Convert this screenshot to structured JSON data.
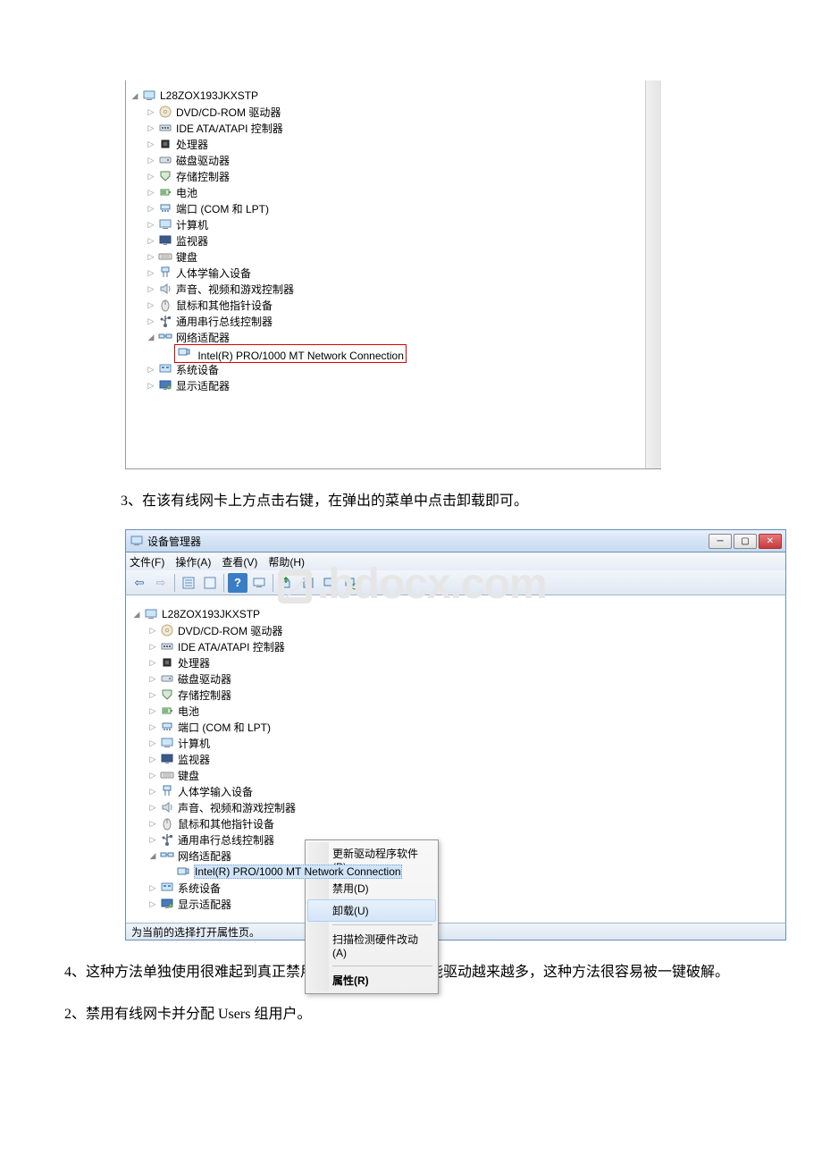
{
  "tree1": {
    "root": "L28ZOX193JKXSTP",
    "items": [
      {
        "label": "DVD/CD-ROM 驱动器",
        "icon": "disc"
      },
      {
        "label": "IDE ATA/ATAPI 控制器",
        "icon": "ide"
      },
      {
        "label": "处理器",
        "icon": "cpu"
      },
      {
        "label": "磁盘驱动器",
        "icon": "drive"
      },
      {
        "label": "存储控制器",
        "icon": "storage"
      },
      {
        "label": "电池",
        "icon": "battery"
      },
      {
        "label": "端口 (COM 和 LPT)",
        "icon": "port"
      },
      {
        "label": "计算机",
        "icon": "computer"
      },
      {
        "label": "监视器",
        "icon": "monitor"
      },
      {
        "label": "键盘",
        "icon": "keyboard"
      },
      {
        "label": "人体学输入设备",
        "icon": "hid"
      },
      {
        "label": "声音、视频和游戏控制器",
        "icon": "sound"
      },
      {
        "label": "鼠标和其他指针设备",
        "icon": "mouse"
      },
      {
        "label": "通用串行总线控制器",
        "icon": "usb"
      }
    ],
    "network_label": "网络适配器",
    "network_child": "Intel(R) PRO/1000 MT Network Connection",
    "tail": [
      {
        "label": "系统设备",
        "icon": "system"
      },
      {
        "label": "显示适配器",
        "icon": "display"
      }
    ]
  },
  "paragraphs": {
    "p3": "3、在该有线网卡上方点击右键，在弹出的菜单中点击卸载即可。",
    "p4": "4、这种方法单独使用很难起到真正禁用有线网卡，现在万能驱动越来越多，这种方法很容易被一键破解。",
    "p2": "2、禁用有线网卡并分配 Users 组用户。"
  },
  "window": {
    "title": "设备管理器",
    "menus": [
      "文件(F)",
      "操作(A)",
      "查看(V)",
      "帮助(H)"
    ],
    "status": "为当前的选择打开属性页。"
  },
  "context_menu": {
    "items": [
      "更新驱动程序软件(P)...",
      "禁用(D)",
      "卸载(U)"
    ],
    "scan": "扫描检测硬件改动(A)",
    "props": "属性(R)"
  },
  "watermark": ".bdocx.com"
}
